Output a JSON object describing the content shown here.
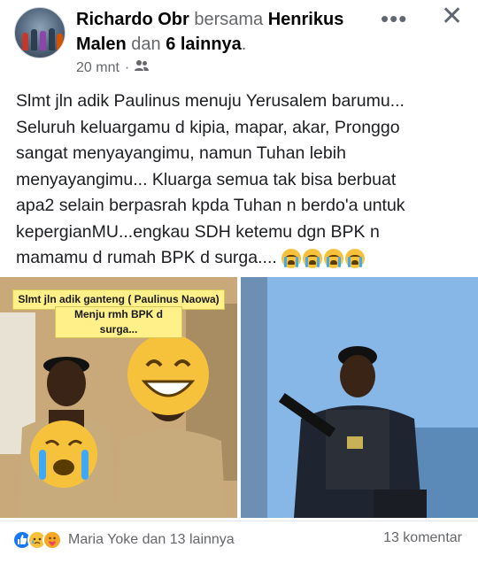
{
  "post": {
    "author": "Richardo Obr",
    "with_word": "bersama",
    "tagged": "Henrikus Malen",
    "and_word": "dan",
    "others": "6 lainnya",
    "time": "20 mnt",
    "audience_icon": "friends-icon",
    "text_lines": [
      "Slmt jln adik Paulinus menuju Yerusalem barumu...",
      "Seluruh keluargamu d kipia, mapar, akar, Pronggo",
      "sangat menyayangimu, namun Tuhan lebih",
      "menyayangimu... Kluarga semua tak bisa berbuat",
      "apa2 selain berpasrah kpda Tuhan n berdo'a untuk",
      "kepergianMU...engkau SDH ketemu dgn BPK n",
      "mamamu d rumah BPK d surga...."
    ]
  },
  "photo_left": {
    "caption_line1": "Slmt jln adik ganteng ( Paulinus Naowa)",
    "caption_line2": "Menju rmh BPK d surga..."
  },
  "footer": {
    "reactions_text": "Maria Yoke dan 13 lainnya",
    "comments": "13 komentar",
    "reaction_icons": [
      "like-icon",
      "sad-icon",
      "care-icon"
    ]
  },
  "colors": {
    "like": "#1877f2",
    "meta_gray": "#65676b",
    "caption_bg": "#fff08a"
  }
}
